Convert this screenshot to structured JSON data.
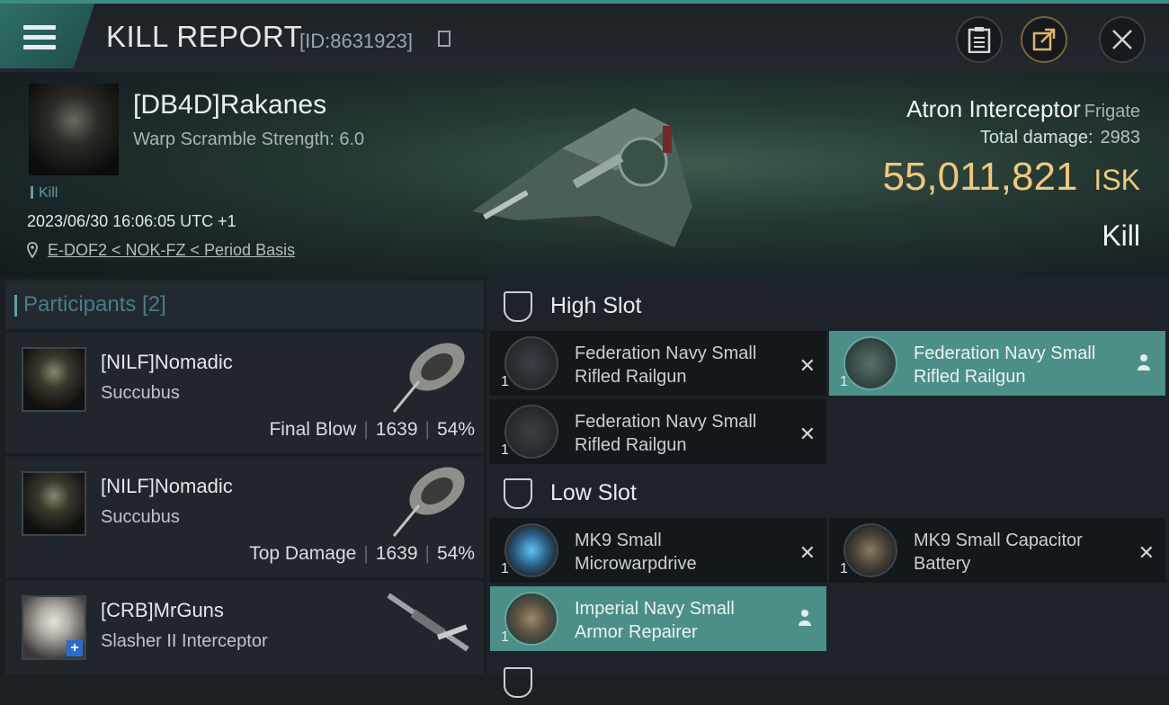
{
  "header": {
    "title": "KILL REPORT",
    "report_id": "[ID:8631923]"
  },
  "victim": {
    "name": "[DB4D]Rakanes",
    "scramble": "Warp Scramble Strength: 6.0",
    "tag": "Kill",
    "datetime": "2023/06/30 16:06:05 UTC +1",
    "location": "E-DOF2 < NOK-FZ < Period Basis",
    "ship": "Atron Interceptor",
    "ship_class": "Frigate",
    "total_damage_label": "Total damage:",
    "total_damage": "2983",
    "isk_value": "55,011,821",
    "isk_unit": "ISK",
    "result": "Kill"
  },
  "participants": {
    "label": "Participants [2]",
    "rows": [
      {
        "name": "[NILF]Nomadic",
        "ship": "Succubus",
        "role": "Final Blow",
        "damage": "1639",
        "percent": "54%"
      },
      {
        "name": "[NILF]Nomadic",
        "ship": "Succubus",
        "role": "Top Damage",
        "damage": "1639",
        "percent": "54%"
      },
      {
        "name": "[CRB]MrGuns",
        "ship": "Slasher II Interceptor",
        "role": "",
        "damage": "",
        "percent": ""
      }
    ]
  },
  "fitting": {
    "high_slot": "High Slot",
    "low_slot": "Low Slot",
    "modules": [
      {
        "name": "Federation Navy Small Rifled Railgun",
        "qty": "1"
      },
      {
        "name": "Federation Navy Small Rifled Railgun",
        "qty": "1"
      },
      {
        "name": "Federation Navy Small Rifled Railgun",
        "qty": "1"
      },
      {
        "name": "MK9 Small Microwarpdrive",
        "qty": "1"
      },
      {
        "name": "MK9 Small Capacitor Battery",
        "qty": "1"
      },
      {
        "name": "Imperial Navy Small Armor Repairer",
        "qty": "1"
      }
    ]
  },
  "colors": {
    "accent": "#4b8f88",
    "isk": "#f0c87c",
    "participants_label": "#497d85"
  }
}
